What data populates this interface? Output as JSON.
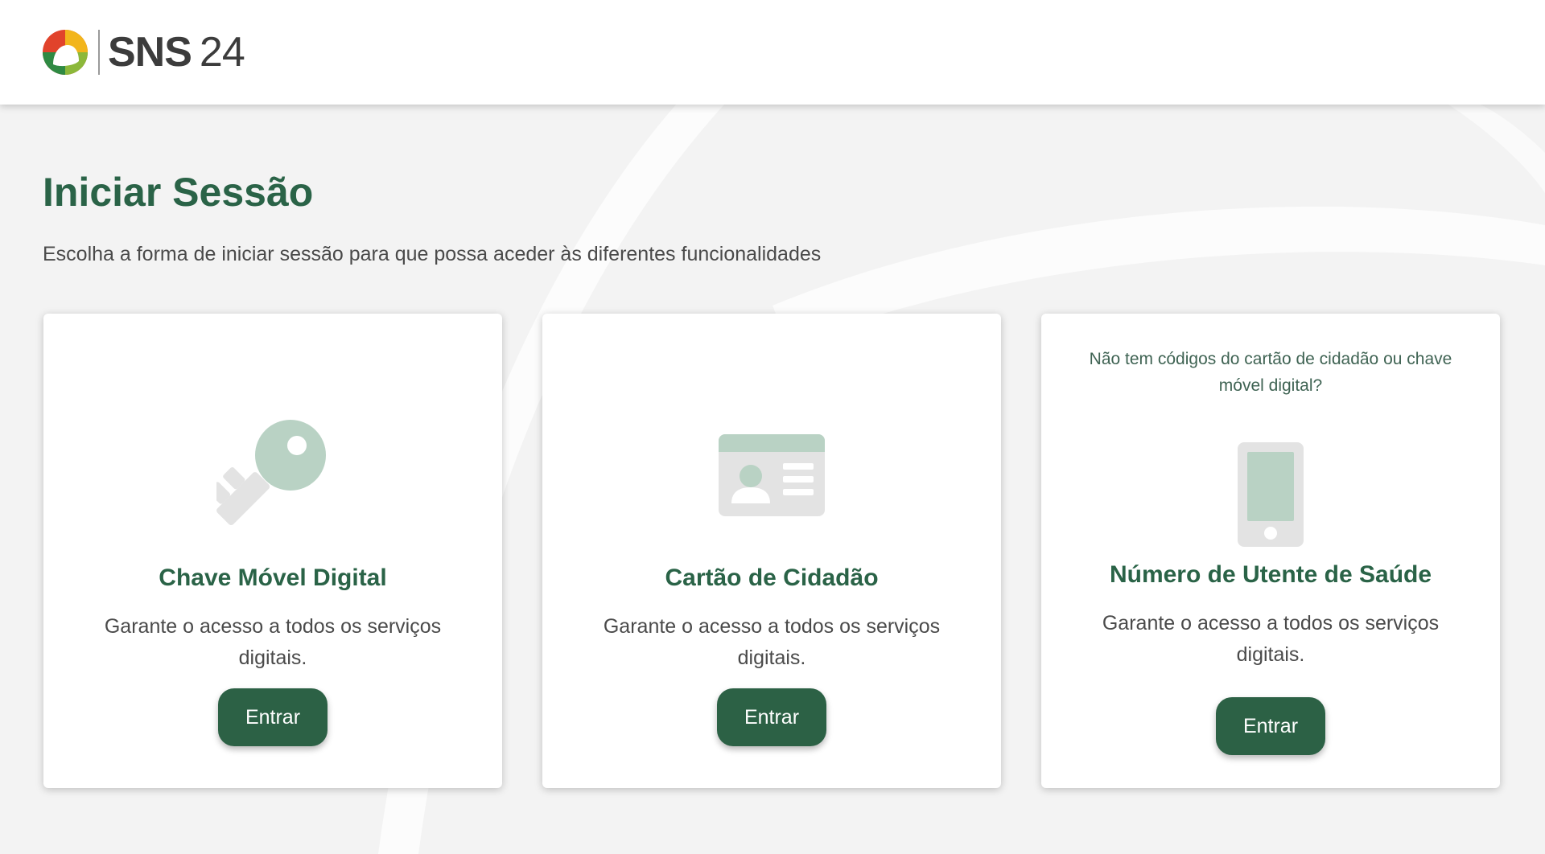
{
  "header": {
    "logo_sns": "SNS",
    "logo_number": "24"
  },
  "main": {
    "title": "Iniciar Sessão",
    "subtitle": "Escolha a forma de iniciar sessão para que possa aceder às diferentes funcionalidades"
  },
  "cards": [
    {
      "icon": "key-icon",
      "title": "Chave Móvel Digital",
      "description": "Garante o acesso a todos os serviços digitais.",
      "button_label": "Entrar"
    },
    {
      "icon": "id-card-icon",
      "title": "Cartão de Cidadão",
      "description": "Garante o acesso a todos os serviços digitais.",
      "button_label": "Entrar"
    },
    {
      "icon": "phone-icon",
      "note": "Não tem códigos do cartão de cidadão ou chave móvel digital?",
      "title": "Número de Utente de Saúde",
      "description": "Garante o acesso a todos os serviços digitais.",
      "button_label": "Entrar"
    }
  ],
  "colors": {
    "brand_green": "#2a6347",
    "button_green": "#2c6145",
    "icon_green_light": "#b9d2c4",
    "icon_gray": "#e3e3e3"
  }
}
